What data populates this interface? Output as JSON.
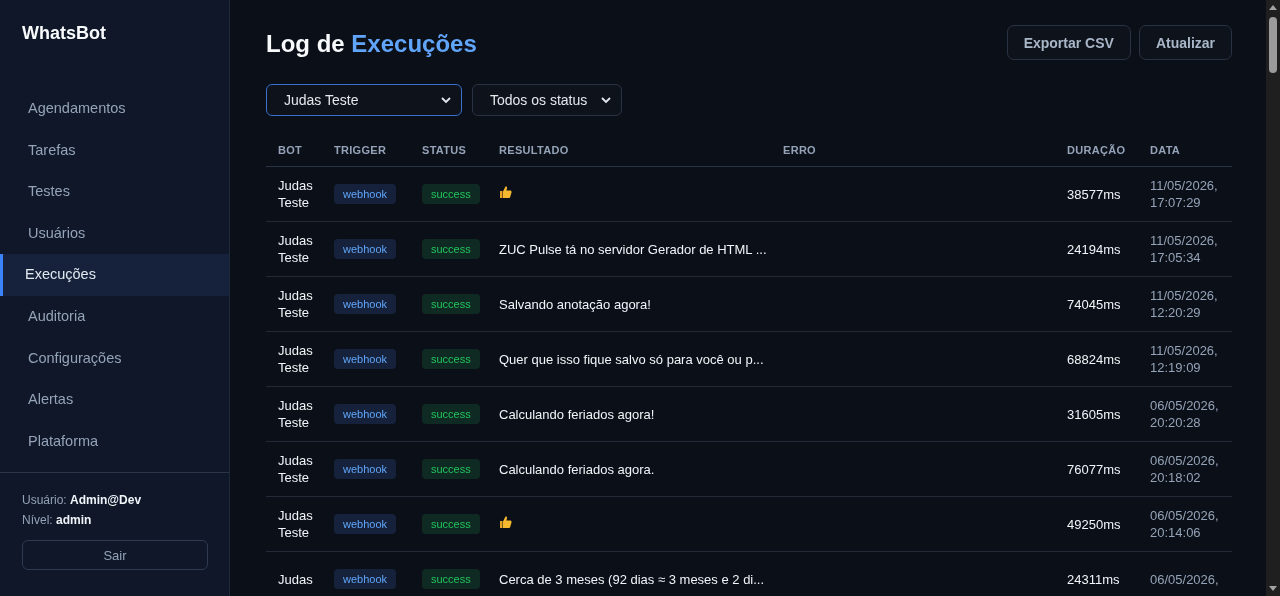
{
  "sidebar": {
    "brand": "WhatsBot",
    "items": [
      {
        "label": "Agendamentos",
        "selected": false
      },
      {
        "label": "Tarefas",
        "selected": false
      },
      {
        "label": "Testes",
        "selected": false
      },
      {
        "label": "Usuários",
        "selected": false
      },
      {
        "label": "Execuções",
        "selected": true
      },
      {
        "label": "Auditoria",
        "selected": false
      },
      {
        "label": "Configurações",
        "selected": false
      },
      {
        "label": "Alertas",
        "selected": false
      },
      {
        "label": "Plataforma",
        "selected": false
      }
    ],
    "user": "Usuário: **Admin@Dev**",
    "level": "Nível: **admin**",
    "logout": "Sair"
  },
  "header": {
    "title": "Log de",
    "title_accent": "Execuções",
    "buttons": [
      "Exportar CSV",
      "Atualizar"
    ]
  },
  "filters": [
    {
      "value": "Judas Teste",
      "focused": true
    },
    {
      "value": "Todos os status",
      "focused": false
    }
  ],
  "table": {
    "columns": [
      "BOT",
      "TRIGGER",
      "STATUS",
      "RESULTADO",
      "ERRO",
      "DURAÇÃO",
      "DATA"
    ],
    "rows": [
      {
        "bot": "Judas Teste",
        "trigger": "webhook",
        "status": "success",
        "kind": "thumbs-up",
        "duration": "38577ms",
        "date": "11/05/2026, 17:07:29"
      },
      {
        "bot": "Judas Teste",
        "trigger": "webhook",
        "status": "success",
        "kind": "text",
        "result": "ZUC Pulse tá no servidor Gerador de HTML ...",
        "duration": "24194ms",
        "date": "11/05/2026, 17:05:34"
      },
      {
        "bot": "Judas Teste",
        "trigger": "webhook",
        "status": "success",
        "kind": "text",
        "result": "Salvando anotação agora!",
        "duration": "74045ms",
        "date": "11/05/2026, 12:20:29"
      },
      {
        "bot": "Judas Teste",
        "trigger": "webhook",
        "status": "success",
        "kind": "text",
        "result": "Quer que isso fique salvo só para você ou p...",
        "duration": "68824ms",
        "date": "11/05/2026, 12:19:09"
      },
      {
        "bot": "Judas Teste",
        "trigger": "webhook",
        "status": "success",
        "kind": "text",
        "result": "Calculando feriados agora!",
        "duration": "31605ms",
        "date": "06/05/2026, 20:20:28"
      },
      {
        "bot": "Judas Teste",
        "trigger": "webhook",
        "status": "success",
        "kind": "text",
        "result": "Calculando feriados agora.",
        "duration": "76077ms",
        "date": "06/05/2026, 20:18:02"
      },
      {
        "bot": "Judas Teste",
        "trigger": "webhook",
        "status": "success",
        "kind": "thumbs-up",
        "duration": "49250ms",
        "date": "06/05/2026, 20:14:06"
      },
      {
        "bot": "Judas",
        "trigger": "webhook",
        "status": "success",
        "kind": "text",
        "result": "Cerca de 3 meses (92 dias ≈ 3 meses e 2 di...",
        "duration": "24311ms",
        "date": "06/05/2026,"
      }
    ]
  }
}
